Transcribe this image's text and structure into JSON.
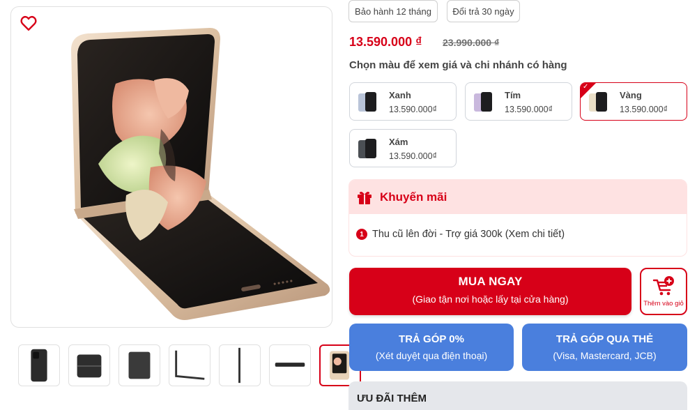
{
  "gallery": {
    "wishlist_icon": "heart-icon",
    "main_image": "samsung-galaxy-z-flip4-gold",
    "thumbnails": [
      "front-black",
      "folded-black",
      "back-black",
      "side-open",
      "side-edge",
      "folded-side",
      "gold-selected"
    ]
  },
  "chips": {
    "warranty": "Bảo hành 12 tháng",
    "return": "Đổi trả 30 ngày"
  },
  "price": {
    "current": "13.590.000 ₫",
    "original": "23.990.000 ₫"
  },
  "color_section": {
    "heading": "Chọn màu để xem giá và chi nhánh có hàng",
    "options": [
      {
        "name": "Xanh",
        "price": "13.590.000₫",
        "color": "#b9c4d8"
      },
      {
        "name": "Tím",
        "price": "13.590.000₫",
        "color": "#c9b8dd"
      },
      {
        "name": "Vàng",
        "price": "13.590.000₫",
        "color": "#eadfc8"
      },
      {
        "name": "Xám",
        "price": "13.590.000₫",
        "color": "#4b4f54"
      }
    ],
    "selected": "Vàng"
  },
  "promotion": {
    "title": "Khuyến mãi",
    "icon": "gift-icon",
    "items": [
      {
        "number": "1",
        "text": "Thu cũ lên đời - Trợ giá 300k (Xem chi tiết)"
      }
    ]
  },
  "buy_now": {
    "title": "MUA NGAY",
    "subtitle": "(Giao tận nơi hoặc lấy tại cửa hàng)"
  },
  "add_to_cart": {
    "label": "Thêm vào giỏ",
    "icon": "cart-plus-icon"
  },
  "installment": {
    "zero_percent": {
      "title": "TRẢ GÓP 0%",
      "subtitle": "(Xét duyệt qua điện thoại)"
    },
    "card": {
      "title": "TRẢ GÓP QUA THẺ",
      "subtitle": "(Visa, Mastercard, JCB)"
    }
  },
  "extra_offers": {
    "title": "ƯU ĐÃI THÊM"
  },
  "colors": {
    "accent": "#d70018",
    "promo_bg": "#fee2e2",
    "installment_blue": "#4a7fdd",
    "extra_bg": "#e5e7eb"
  }
}
